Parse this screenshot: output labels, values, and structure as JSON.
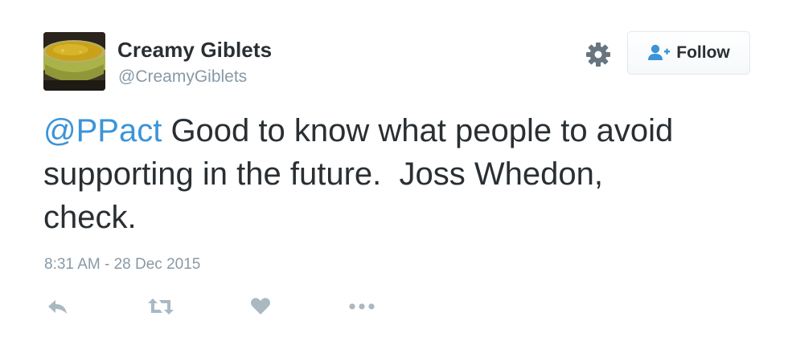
{
  "tweet": {
    "user": {
      "name": "Creamy Giblets",
      "handle": "@CreamyGiblets"
    },
    "follow_button": {
      "label": "Follow",
      "icon": "follow-user-icon"
    },
    "settings_icon": "gear-icon",
    "text": {
      "mention": "@PPact",
      "line1": " Good to know what people to avoid",
      "line2": "supporting in the future.  Joss Whedon,",
      "line3": "check."
    },
    "timestamp": "8:31 AM - 28 Dec 2015",
    "actions": [
      {
        "name": "reply",
        "icon": "reply-icon"
      },
      {
        "name": "retweet",
        "icon": "retweet-icon"
      },
      {
        "name": "like",
        "icon": "heart-icon"
      },
      {
        "name": "more",
        "icon": "more-icon"
      }
    ],
    "colors": {
      "text": "#292f33",
      "link": "#3b94d9",
      "muted": "#8899a6",
      "icon": "#aab8c2",
      "follow_icon": "#3b94d9"
    }
  }
}
